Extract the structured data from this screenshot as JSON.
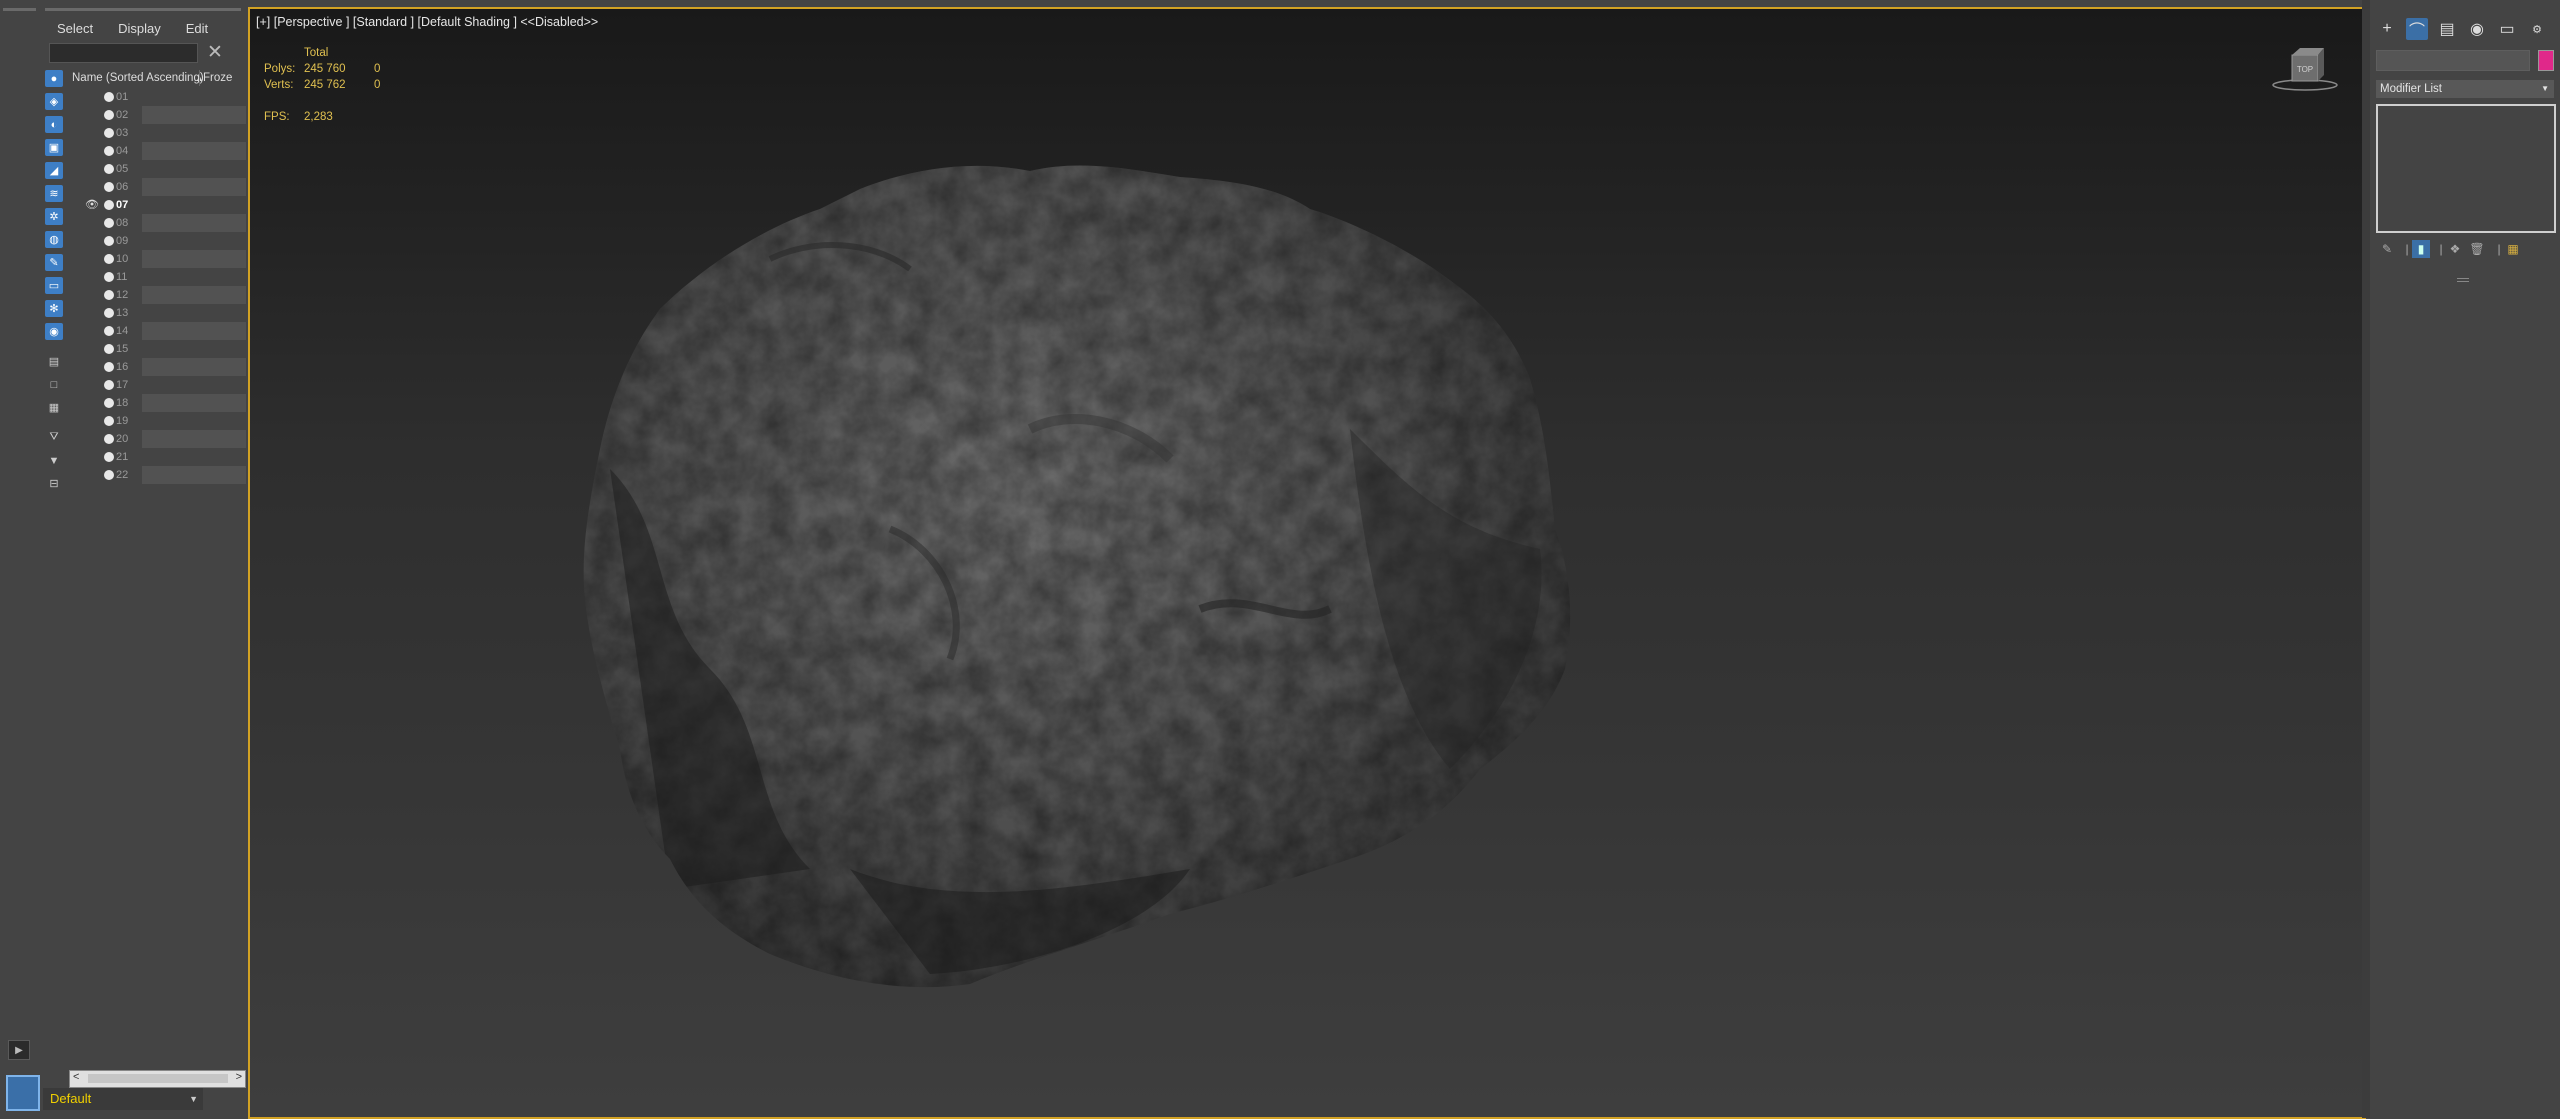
{
  "explorer": {
    "menu": [
      "Select",
      "Display",
      "Edit"
    ],
    "column_name": "Name (Sorted Ascending)",
    "column_sort_indicator": "▲",
    "column_frozen": "Froze",
    "items": [
      "01",
      "02",
      "03",
      "04",
      "05",
      "06",
      "07",
      "08",
      "09",
      "10",
      "11",
      "12",
      "13",
      "14",
      "15",
      "16",
      "17",
      "18",
      "19",
      "20",
      "21",
      "22"
    ],
    "active_item": "07",
    "layer": "Default"
  },
  "viewport": {
    "label": "[+] [Perspective ] [Standard ] [Default Shading ]  <<Disabled>>",
    "stats": {
      "total_label": "Total",
      "polys_label": "Polys:",
      "polys_total": "245 760",
      "polys_sel": "0",
      "verts_label": "Verts:",
      "verts_total": "245 762",
      "verts_sel": "0",
      "fps_label": "FPS:",
      "fps_value": "2,283"
    },
    "viewcube_face": "TOP"
  },
  "command_panel": {
    "modifier_list": "Modifier List",
    "object_color": "#e0288a"
  },
  "colors": {
    "viewport_border": "#d2a223",
    "stats_text": "#e0c050",
    "accent_blue": "#3e7fc6"
  }
}
